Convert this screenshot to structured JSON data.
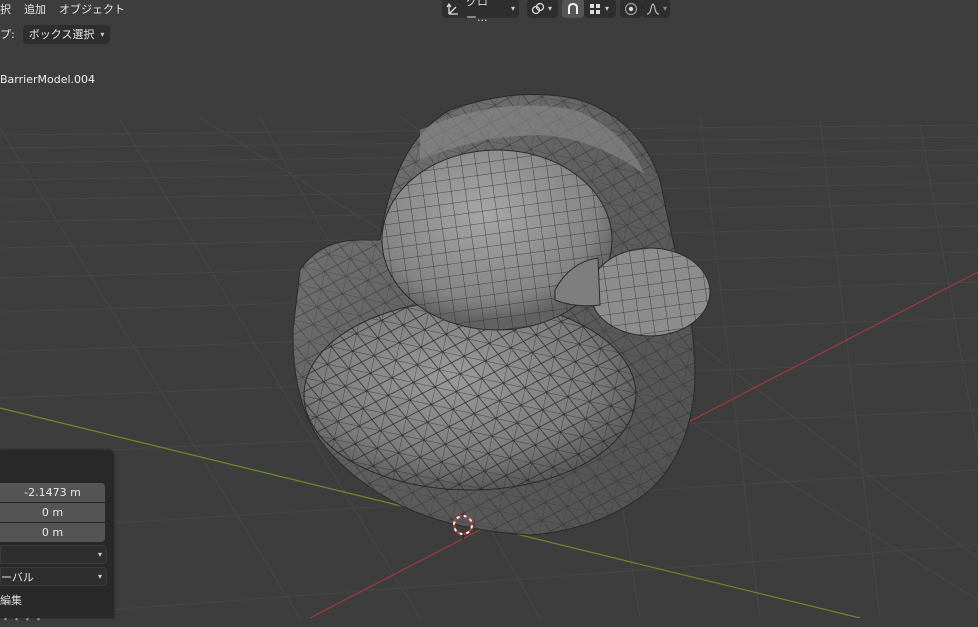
{
  "header": {
    "menu": [
      "択",
      "追加",
      "オブジェクト"
    ],
    "transform_orientation": "グロー...",
    "icons": [
      "transform-orientation-icon",
      "link-icon",
      "snap-icon",
      "snap-grid-icon",
      "proportional-edit-icon",
      "falloff-curve-icon"
    ]
  },
  "tool_settings": {
    "drag_label": "プ:",
    "drag_value": "ボックス選択"
  },
  "viewport": {
    "object_name": "BarrierModel.004",
    "grid_color": "#474747",
    "x_axis_color": "#9e3a3a",
    "y_axis_color": "#6a8c2b"
  },
  "operator_panel": {
    "fields": [
      "-2.1473 m",
      "0 m",
      "0 m"
    ],
    "orientation_value": "ーバル",
    "option_label": "編集",
    "partial_label": "・・・・"
  }
}
